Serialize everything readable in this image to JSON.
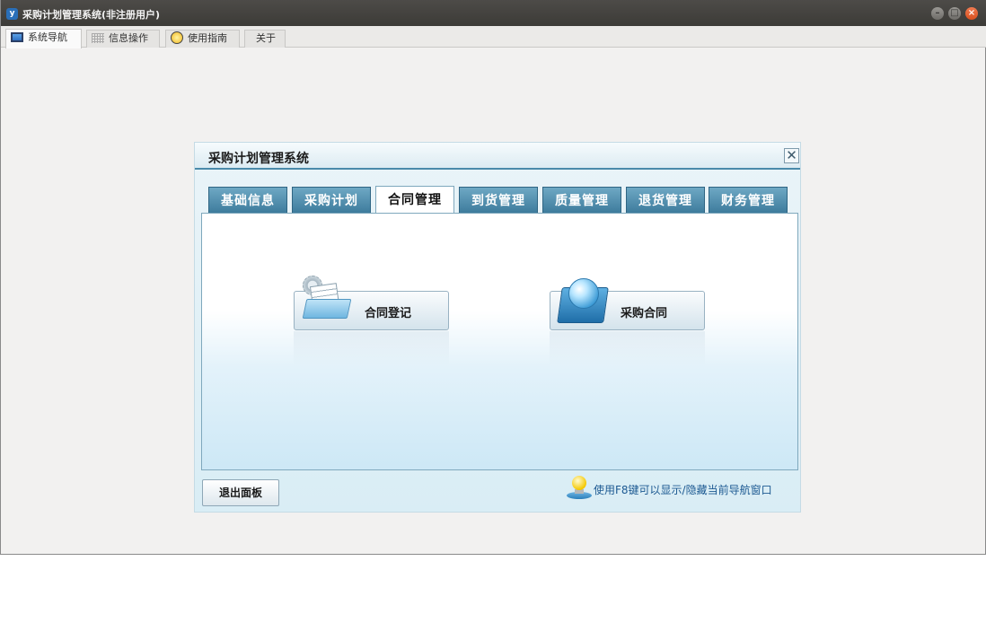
{
  "window": {
    "logo_text": "y",
    "title": "采购计划管理系统(非注册用户)",
    "min_symbol": "–",
    "max_symbol": "□",
    "close_symbol": "×"
  },
  "top_tabs": [
    {
      "label": "系统导航",
      "icon": "monitor-icon",
      "active": true
    },
    {
      "label": "信息操作",
      "icon": "grid-icon",
      "active": false
    },
    {
      "label": "使用指南",
      "icon": "guide-icon",
      "active": false
    },
    {
      "label": "关于",
      "icon": "",
      "active": false
    }
  ],
  "panel": {
    "title": "采购计划管理系统",
    "close_symbol": "✕",
    "module_tabs": [
      {
        "label": "基础信息",
        "active": false
      },
      {
        "label": "采购计划",
        "active": false
      },
      {
        "label": "合同管理",
        "active": true
      },
      {
        "label": "到货管理",
        "active": false
      },
      {
        "label": "质量管理",
        "active": false
      },
      {
        "label": "退货管理",
        "active": false
      },
      {
        "label": "财务管理",
        "active": false
      }
    ],
    "functions": [
      {
        "label": "合同登记",
        "icon": "folder-document-icon"
      },
      {
        "label": "采购合同",
        "icon": "globe-icon"
      }
    ],
    "exit_label": "退出面板",
    "hint_text": "使用F8键可以显示/隐藏当前导航窗口",
    "hint_icon": "lightbulb-icon"
  },
  "colors": {
    "titlebar": "#3c3b37",
    "module_tab": "#3c7a9b",
    "panel_border": "#4a8aaa",
    "hint_text": "#1d5a92"
  }
}
